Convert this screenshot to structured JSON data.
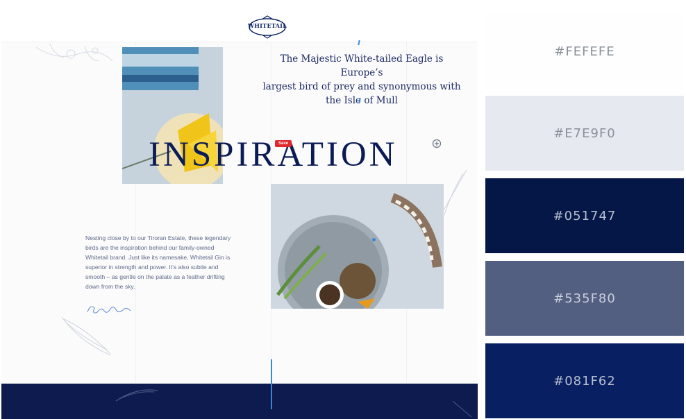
{
  "website": {
    "logo_text": "WHITETAIL",
    "tagline": [
      "The Majestic White-tailed Eagle is Europe’s",
      "largest bird of prey and synonymous with",
      "the Isle of Mull"
    ],
    "headline": "INSPIRATION",
    "save_button": "Save",
    "body_copy": [
      "Nesting close by to our Tiroran Estate, these legendary",
      "birds are the inspiration behind our family-owned",
      "Whitetail brand. Just like its namesake, Whitetail Gin is",
      "superior in strength and power. It’s also subtle and",
      "smooth – as gentle on the palate as a feather drifting",
      "down from the sky."
    ],
    "colors": {
      "navy": "#0b1b55",
      "footer": "#0d1b4f",
      "accent": "#3a87d6",
      "save": "#e0282e"
    }
  },
  "palette": {
    "swatches": [
      {
        "hex": "#FEFEFE",
        "label": "#FEFEFE",
        "text_color": "#8a8f98"
      },
      {
        "hex": "#E7E9F0",
        "label": "#E7E9F0",
        "text_color": "#8a8f98"
      },
      {
        "hex": "#051747",
        "label": "#051747",
        "text_color": "#b8bfd0"
      },
      {
        "hex": "#535F80",
        "label": "#535F80",
        "text_color": "#c9cfdd"
      },
      {
        "hex": "#081F62",
        "label": "#081F62",
        "text_color": "#b8bfd0"
      }
    ]
  }
}
